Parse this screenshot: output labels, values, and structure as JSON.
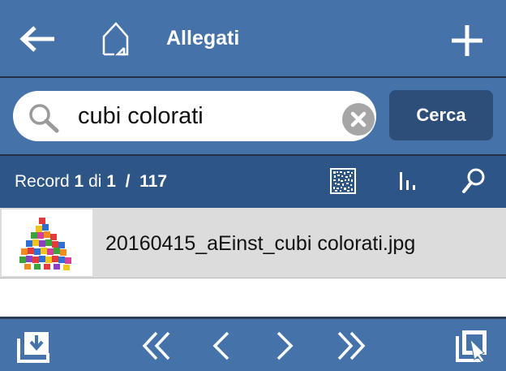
{
  "header": {
    "title": "Allegati",
    "icons": {
      "back": "arrow-left-icon",
      "home": "home-icon",
      "add": "plus-icon"
    }
  },
  "search": {
    "value": "cubi colorati",
    "button_label": "Cerca",
    "icons": {
      "search": "magnifier-icon",
      "clear": "clear-icon"
    }
  },
  "record": {
    "prefix": "Record",
    "current": "1",
    "of_word": "di",
    "filtered_total": "1",
    "separator": "/",
    "total": "117",
    "icons": [
      "qr-code-icon",
      "bar-chart-icon",
      "search-icon"
    ]
  },
  "rows": [
    {
      "filename": "20160415_aEinst_cubi colorati.jpg",
      "thumbnail": "colored-cubes-thumbnail"
    }
  ],
  "footer": {
    "icons": [
      "download-icon",
      "first-page-icon",
      "previous-page-icon",
      "next-page-icon",
      "last-page-icon",
      "open-external-icon"
    ]
  },
  "colors": {
    "header_bg": "#4472a9",
    "record_bar_bg": "#2d5686",
    "button_bg": "#2d4e78",
    "row_bg": "#dcdcdc"
  }
}
